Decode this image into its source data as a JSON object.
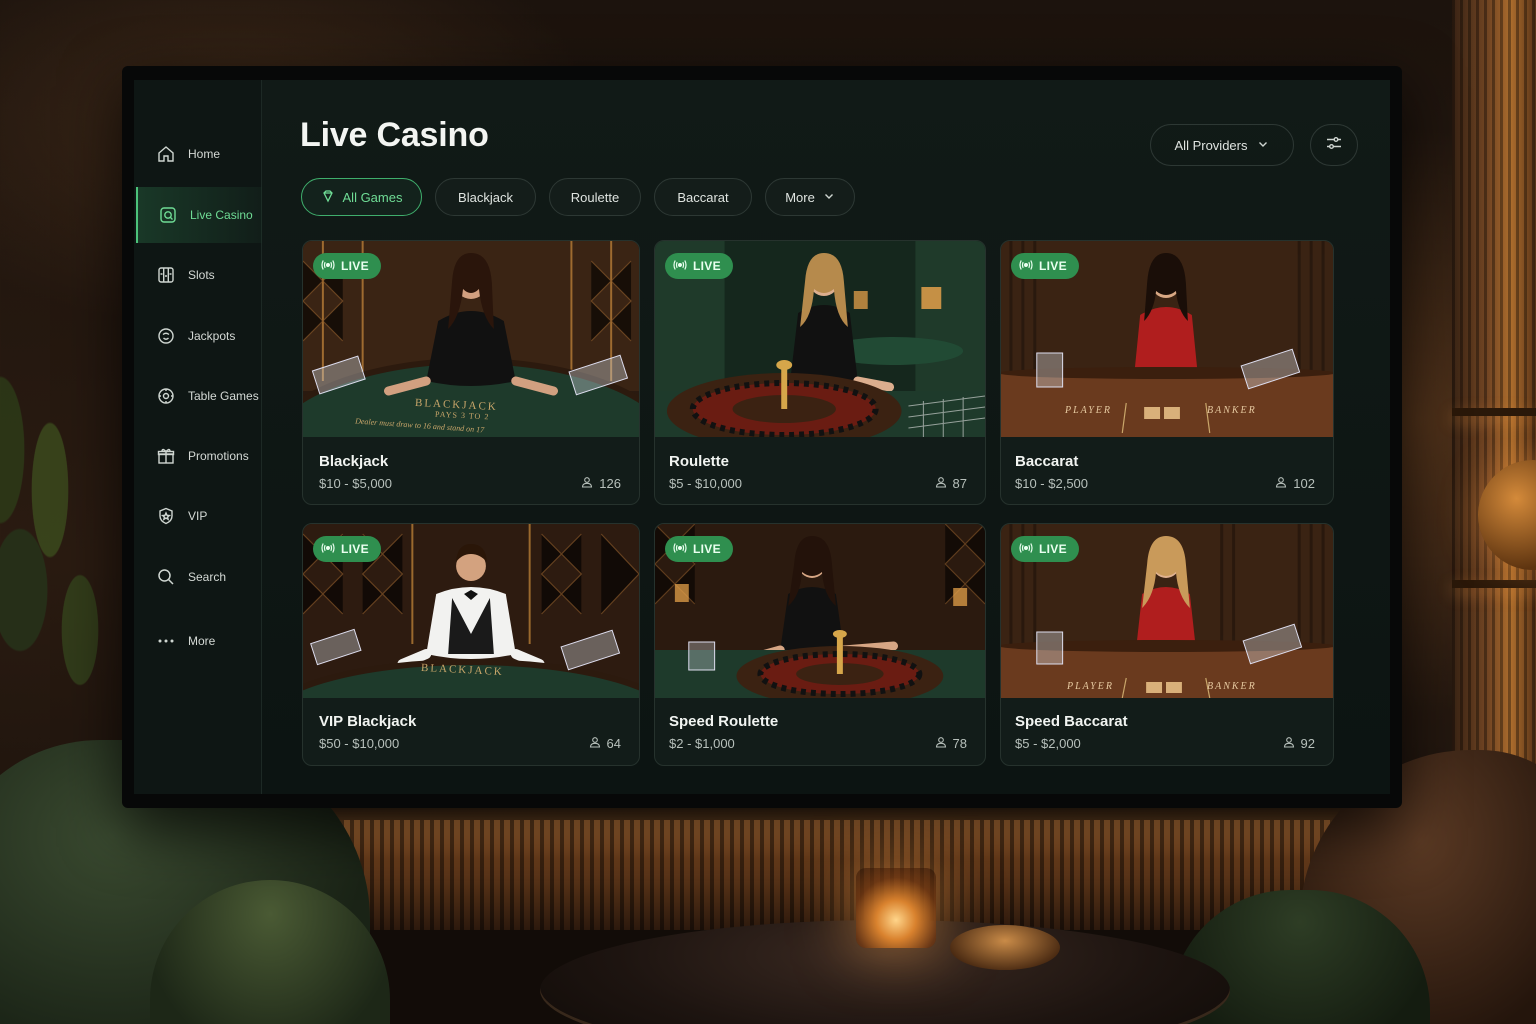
{
  "sidebar": {
    "items": [
      {
        "label": "Home",
        "icon": "home-icon"
      },
      {
        "label": "Live Casino",
        "icon": "live-casino-icon",
        "active": true
      },
      {
        "label": "Slots",
        "icon": "slots-icon"
      },
      {
        "label": "Jackpots",
        "icon": "jackpots-icon"
      },
      {
        "label": "Table Games",
        "icon": "table-games-icon"
      },
      {
        "label": "Promotions",
        "icon": "gift-icon"
      },
      {
        "label": "VIP",
        "icon": "vip-icon"
      },
      {
        "label": "Search",
        "icon": "search-icon"
      },
      {
        "label": "More",
        "icon": "more-dots-icon"
      }
    ]
  },
  "header": {
    "title": "Live Casino",
    "providers_label": "All Providers"
  },
  "chips": [
    {
      "label": "All Games",
      "active": true
    },
    {
      "label": "Blackjack"
    },
    {
      "label": "Roulette"
    },
    {
      "label": "Baccarat"
    },
    {
      "label": "More"
    }
  ],
  "games": [
    {
      "badge": "LIVE",
      "title": "Blackjack",
      "limits": "$10 - $5,000",
      "players": "126",
      "table_text": [
        "BLACKJACK",
        "PAYS 3 TO 2",
        "Dealer must draw to 16 and stand on 17"
      ]
    },
    {
      "badge": "LIVE",
      "title": "Roulette",
      "limits": "$5 - $10,000",
      "players": "87"
    },
    {
      "badge": "LIVE",
      "title": "Baccarat",
      "limits": "$10 - $2,500",
      "players": "102",
      "table_text": [
        "PLAYER",
        "BANKER"
      ]
    },
    {
      "badge": "LIVE",
      "title": "VIP Blackjack",
      "limits": "$50 - $10,000",
      "players": "64",
      "table_text": [
        "BLACKJACK"
      ]
    },
    {
      "badge": "LIVE",
      "title": "Speed Roulette",
      "limits": "$2 - $1,000",
      "players": "78"
    },
    {
      "badge": "LIVE",
      "title": "Speed Baccarat",
      "limits": "$5 - $2,000",
      "players": "92",
      "table_text": [
        "PLAYER",
        "BANKER"
      ]
    }
  ],
  "colors": {
    "accent": "#4cc27a",
    "live_badge": "#2f8f4f",
    "screen_bg": "#0c1412"
  }
}
